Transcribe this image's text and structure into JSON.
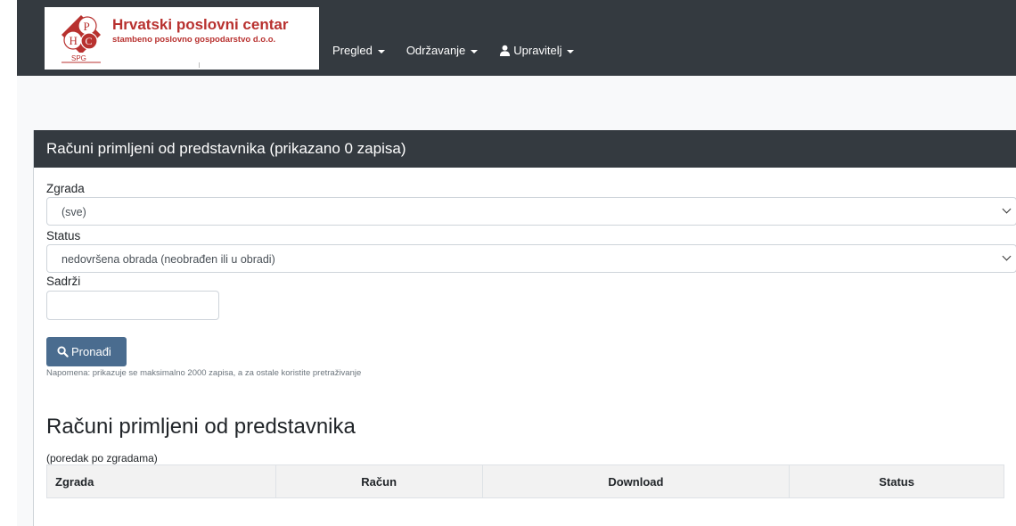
{
  "brand": {
    "title": "Hrvatski poslovni centar",
    "subtitle": "stambeno poslovno gospodarstvo d.o.o.",
    "mark_letters": [
      "H",
      "P",
      "C"
    ],
    "mark_tag": "SPG",
    "color": "#b8312f"
  },
  "nav": {
    "items": [
      {
        "label": "Pregled",
        "icon": "caret-down-icon"
      },
      {
        "label": "Održavanje",
        "icon": "caret-down-icon"
      },
      {
        "label": "Upravitelj",
        "icon": "user-icon"
      }
    ]
  },
  "panel": {
    "header": "Računi primljeni od predstavnika (prikazano 0 zapisa)"
  },
  "form": {
    "zgrada_label": "Zgrada",
    "zgrada_value": "(sve)",
    "status_label": "Status",
    "status_value": "nedovršena obrada (neobrađen ili u obradi)",
    "sadrzi_label": "Sadrži",
    "sadrzi_value": "",
    "search_button": "Pronađi",
    "note": "Napomena: prikazuje se maksimalno 2000 zapisa, a za ostale koristite pretraživanje"
  },
  "results": {
    "title": "Računi primljeni od predstavnika",
    "order_note": "(poredak po zgradama)",
    "columns": [
      "Zgrada",
      "Račun",
      "Download",
      "Status"
    ],
    "rows": []
  },
  "colors": {
    "navbar": "#343a40",
    "button": "#4a6c8f",
    "brand": "#b8312f"
  }
}
